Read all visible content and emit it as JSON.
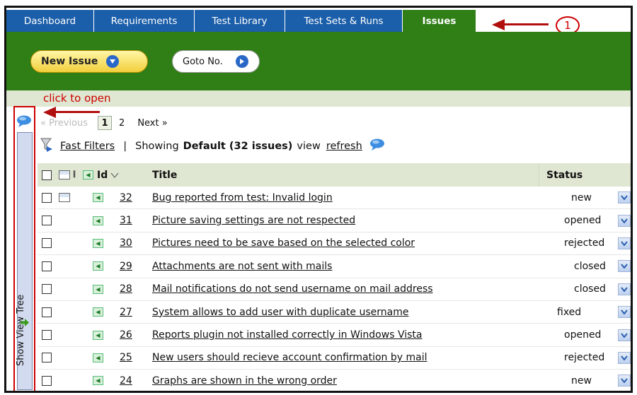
{
  "tabs": [
    {
      "label": "Dashboard",
      "active": false
    },
    {
      "label": "Requirements",
      "active": false
    },
    {
      "label": "Test Library",
      "active": false
    },
    {
      "label": "Test Sets & Runs",
      "active": false
    },
    {
      "label": "Issues",
      "active": true
    }
  ],
  "callout": "1",
  "toolbar": {
    "new_issue": "New Issue",
    "goto": "Goto No."
  },
  "hint": "click to open",
  "side_tab": "Show View Tree",
  "paging": {
    "prev": "« Previous",
    "current": "1",
    "page2": "2",
    "next": "Next »"
  },
  "filters": {
    "fast_filters": "Fast Filters",
    "separator": "|",
    "showing_prefix": "Showing",
    "view_name": "Default (32 issues)",
    "view_suffix": "view",
    "refresh": "refresh"
  },
  "table": {
    "headers": {
      "id": "Id",
      "title": "Title",
      "status": "Status"
    },
    "rows": [
      {
        "id": "32",
        "title": "Bug reported from test: Invalid login",
        "status": "new"
      },
      {
        "id": "31",
        "title": "Picture saving settings are not respected",
        "status": "opened"
      },
      {
        "id": "30",
        "title": "Pictures need to be save based on the selected color",
        "status": "rejected"
      },
      {
        "id": "29",
        "title": "Attachments are not sent with mails",
        "status": "closed"
      },
      {
        "id": "28",
        "title": "Mail notifications do not send username on mail address",
        "status": "closed"
      },
      {
        "id": "27",
        "title": "System allows to add user with duplicate username",
        "status": "fixed"
      },
      {
        "id": "26",
        "title": "Reports plugin not installed correctly in Windows Vista",
        "status": "opened"
      },
      {
        "id": "25",
        "title": "New users should recieve account confirmation by mail",
        "status": "rejected"
      },
      {
        "id": "24",
        "title": "Graphs are shown in the wrong order",
        "status": "new"
      }
    ]
  },
  "colors": {
    "tab_blue": "#1b5ea9",
    "tab_active_green": "#2f7e16",
    "annotation_red": "#c00000"
  }
}
